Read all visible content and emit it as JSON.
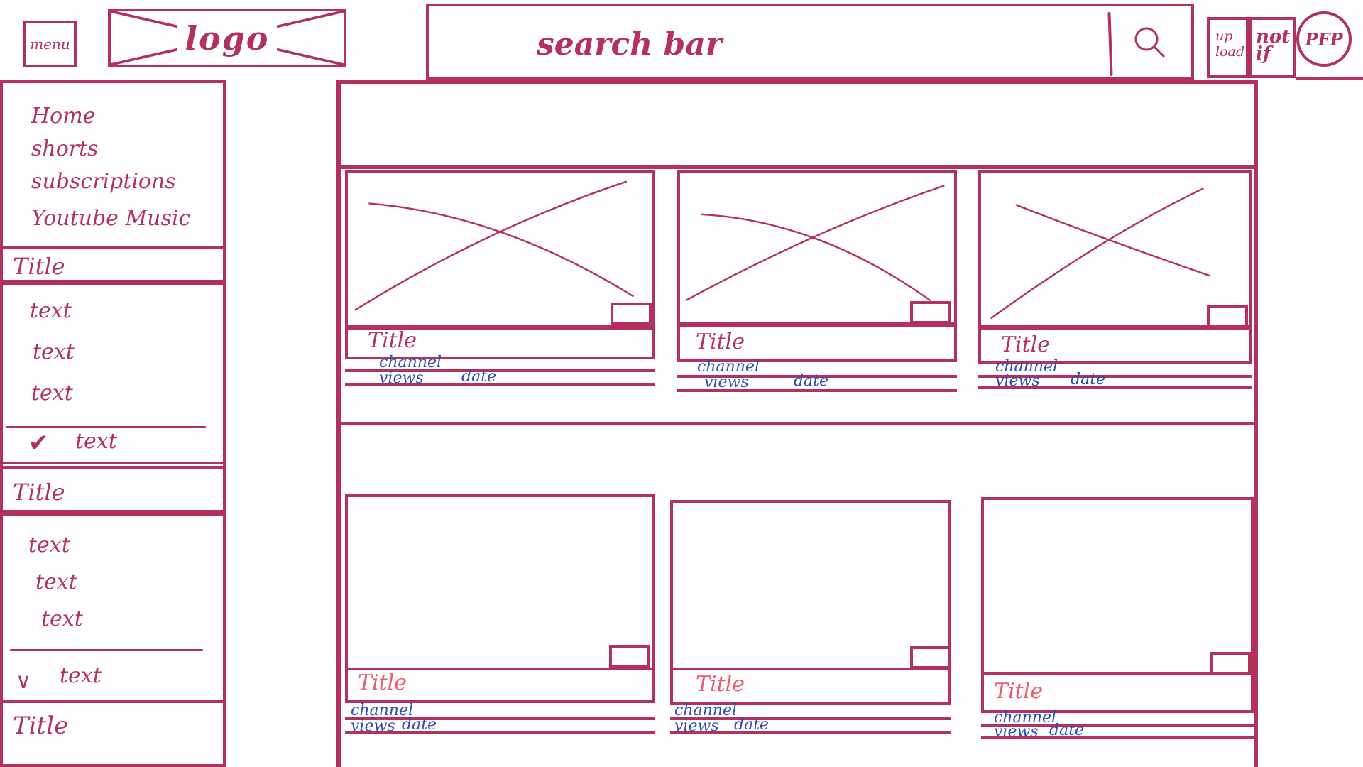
{
  "header": {
    "menu_label": "menu",
    "logo_label": "logo",
    "search_label": "search bar",
    "upload_label_line1": "up",
    "upload_label_line2": "load",
    "notif_label_line1": "not",
    "notif_label_line2": "if",
    "pfp_label": "PFP",
    "search_icon": "search-icon"
  },
  "sidebar": {
    "nav": [
      "Home",
      "shorts",
      "subscriptions",
      "Youtube Music"
    ],
    "section1": {
      "title": "Title",
      "items": [
        "text",
        "text",
        "text"
      ],
      "expand_label": "text",
      "expand_icon": "check-icon"
    },
    "section2": {
      "title": "Title",
      "items": [
        "text",
        "text",
        "text"
      ],
      "expand_label": "text",
      "expand_icon": "chevron-down-icon"
    },
    "section3": {
      "title": "Title"
    }
  },
  "videos": [
    {
      "title": "Title",
      "channel": "channel",
      "views": "views",
      "date": "date"
    },
    {
      "title": "Title",
      "channel": "channel",
      "views": "views",
      "date": "date"
    },
    {
      "title": "Title",
      "channel": "channel",
      "views": "views",
      "date": "date"
    },
    {
      "title": "Title",
      "channel": "channel",
      "views": "views",
      "date": "date"
    },
    {
      "title": "Title",
      "channel": "channel",
      "views": "views",
      "date": "date"
    },
    {
      "title": "Title",
      "channel": "channel",
      "views": "views",
      "date": "date"
    }
  ],
  "colors": {
    "ink": "#b4305e",
    "meta_text": "#2a4fb4",
    "title_highlight": "#ee5b6c"
  }
}
